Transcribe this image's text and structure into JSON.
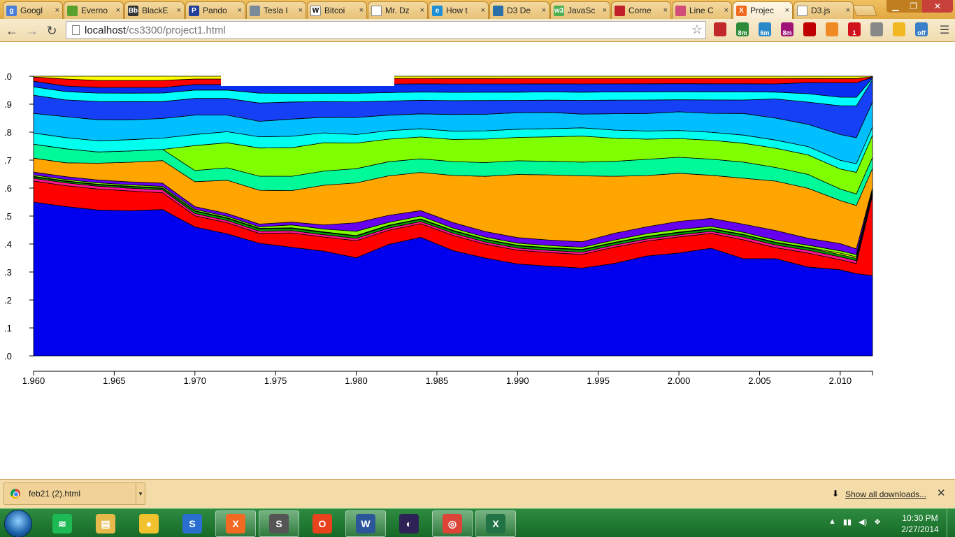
{
  "browser": {
    "tabs": [
      {
        "title": "Googl",
        "icon": "google-icon",
        "color": "#4a7ed8",
        "glyph": "g"
      },
      {
        "title": "Everno",
        "icon": "evernote-icon",
        "color": "#5aa02c",
        "glyph": ""
      },
      {
        "title": "BlackE",
        "icon": "blackboard-icon",
        "color": "#333333",
        "glyph": "Bb"
      },
      {
        "title": "Pando",
        "icon": "pandora-icon",
        "color": "#224099",
        "glyph": "P"
      },
      {
        "title": "Tesla I",
        "icon": "tesla-icon",
        "color": "#7a8a99",
        "glyph": ""
      },
      {
        "title": "Bitcoi",
        "icon": "wikipedia-icon",
        "color": "#ffffff",
        "glyph": "W"
      },
      {
        "title": "Mr. Dz",
        "icon": "page-icon",
        "color": "#ffffff",
        "glyph": ""
      },
      {
        "title": "How t",
        "icon": "ie-icon",
        "color": "#1f8fd6",
        "glyph": "e"
      },
      {
        "title": "D3 De",
        "icon": "d3-icon",
        "color": "#2a6fa8",
        "glyph": ""
      },
      {
        "title": "JavaSc",
        "icon": "w3schools-icon",
        "color": "#4caf50",
        "glyph": "w3"
      },
      {
        "title": "Corne",
        "icon": "cornell-icon",
        "color": "#c0202a",
        "glyph": ""
      },
      {
        "title": "Line C",
        "icon": "line-chart-icon",
        "color": "#d24d7a",
        "glyph": ""
      },
      {
        "title": "Projec",
        "icon": "xampp-icon",
        "color": "#f26a21",
        "glyph": "X",
        "active": true
      },
      {
        "title": "D3.js",
        "icon": "page-icon",
        "color": "#ffffff",
        "glyph": ""
      }
    ],
    "url_host": "localhost",
    "url_path": "/cs3300/project1.html",
    "extensions": [
      {
        "name": "bookmark-ext-icon",
        "color": "#c0282a",
        "badge": ""
      },
      {
        "name": "timer-ext-icon-1",
        "color": "#2e8b3a",
        "badge": "8m"
      },
      {
        "name": "timer-ext-icon-2",
        "color": "#2a87c8",
        "badge": "6m"
      },
      {
        "name": "timer-ext-icon-3",
        "color": "#a0147a",
        "badge": "8m"
      },
      {
        "name": "adblock-ext-icon",
        "color": "#c00000",
        "badge": ""
      },
      {
        "name": "rss-ext-icon",
        "color": "#f08a24",
        "badge": ""
      },
      {
        "name": "feedly-ext-icon",
        "color": "#d0101a",
        "badge": "1"
      },
      {
        "name": "gear-ext-icon",
        "color": "#888888",
        "badge": ""
      },
      {
        "name": "weather-ext-icon",
        "color": "#f2b824",
        "badge": ""
      },
      {
        "name": "download-ext-icon",
        "color": "#3a7fc8",
        "badge": "off"
      }
    ]
  },
  "downloads": {
    "item_label": "feb21 (2).html",
    "show_all": "Show all downloads..."
  },
  "taskbar": {
    "apps": [
      {
        "name": "spotify-icon",
        "color": "#1db954",
        "glyph": "≋",
        "running": false
      },
      {
        "name": "file-explorer-icon",
        "color": "#e7b84a",
        "glyph": "▤",
        "running": false
      },
      {
        "name": "beetle-app-icon",
        "color": "#f2c12e",
        "glyph": "●",
        "running": false
      },
      {
        "name": "sync-app-icon",
        "color": "#2a6fd0",
        "glyph": "S",
        "running": false
      },
      {
        "name": "xampp-icon",
        "color": "#f26a21",
        "glyph": "X",
        "running": true
      },
      {
        "name": "sublime-text-icon",
        "color": "#555555",
        "glyph": "S",
        "running": true
      },
      {
        "name": "office-icon",
        "color": "#e8431c",
        "glyph": "O",
        "running": false
      },
      {
        "name": "word-icon",
        "color": "#2b579a",
        "glyph": "W",
        "running": true
      },
      {
        "name": "eclipse-icon",
        "color": "#2c2255",
        "glyph": "◐",
        "running": false
      },
      {
        "name": "chrome-icon",
        "color": "#db4437",
        "glyph": "◎",
        "running": true
      },
      {
        "name": "excel-icon",
        "color": "#217346",
        "glyph": "X",
        "running": true
      }
    ],
    "time": "10:30 PM",
    "date": "2/27/2014"
  },
  "chart_data": {
    "type": "area",
    "stacked": true,
    "normalized": true,
    "x": [
      1960,
      1962,
      1964,
      1966,
      1968,
      1970,
      1972,
      1974,
      1976,
      1978,
      1980,
      1982,
      1984,
      1986,
      1988,
      1990,
      1992,
      1994,
      1996,
      1998,
      2000,
      2002,
      2004,
      2006,
      2008,
      2010,
      2011,
      2012
    ],
    "xticks": [
      1960,
      1965,
      1970,
      1975,
      1980,
      1985,
      1990,
      1995,
      2000,
      2005,
      2010
    ],
    "xtick_labels": [
      "1.960",
      "1.965",
      "1.970",
      "1.975",
      "1.980",
      "1.985",
      "1.990",
      "1.995",
      "2.000",
      "2.005",
      "2.010"
    ],
    "yticks": [
      0,
      0.1,
      0.2,
      0.3,
      0.4,
      0.5,
      0.6,
      0.7,
      0.8,
      0.9,
      1.0
    ],
    "ytick_labels": [
      ".0",
      ".1",
      ".2",
      ".3",
      ".4",
      ".5",
      ".6",
      ".7",
      ".8",
      ".9",
      ".0"
    ],
    "xlim": [
      1960,
      2012
    ],
    "ylim": [
      0,
      1
    ],
    "series": [
      {
        "color": "#0000ee",
        "values": [
          0.55,
          0.535,
          0.52,
          0.515,
          0.52,
          0.465,
          0.44,
          0.4,
          0.38,
          0.37,
          0.345,
          0.395,
          0.435,
          0.38,
          0.355,
          0.335,
          0.33,
          0.32,
          0.34,
          0.37,
          0.385,
          0.4,
          0.36,
          0.355,
          0.32,
          0.3,
          0.285,
          0.29
        ]
      },
      {
        "color": "#ff0000",
        "values": [
          0.075,
          0.075,
          0.075,
          0.07,
          0.06,
          0.04,
          0.04,
          0.035,
          0.05,
          0.05,
          0.06,
          0.05,
          0.05,
          0.055,
          0.05,
          0.05,
          0.05,
          0.05,
          0.06,
          0.055,
          0.06,
          0.055,
          0.07,
          0.04,
          0.05,
          0.035,
          0.035,
          0.29
        ]
      },
      {
        "color": "#ff1493",
        "values": [
          0.01,
          0.01,
          0.01,
          0.01,
          0.01,
          0.008,
          0.008,
          0.008,
          0.008,
          0.008,
          0.008,
          0.008,
          0.008,
          0.008,
          0.008,
          0.008,
          0.008,
          0.008,
          0.008,
          0.008,
          0.008,
          0.008,
          0.01,
          0.01,
          0.01,
          0.01,
          0.01,
          0.008
        ]
      },
      {
        "color": "#00a000",
        "values": [
          0.005,
          0.005,
          0.005,
          0.005,
          0.005,
          0.008,
          0.008,
          0.008,
          0.008,
          0.008,
          0.008,
          0.008,
          0.008,
          0.008,
          0.008,
          0.008,
          0.008,
          0.008,
          0.008,
          0.008,
          0.008,
          0.008,
          0.008,
          0.008,
          0.008,
          0.008,
          0.008,
          0.006
        ]
      },
      {
        "color": "#ffff00",
        "values": [
          0.002,
          0.002,
          0.002,
          0.002,
          0.002,
          0.002,
          0.002,
          0.002,
          0.002,
          0.002,
          0.002,
          0.002,
          0.002,
          0.002,
          0.002,
          0.002,
          0.002,
          0.002,
          0.002,
          0.002,
          0.002,
          0.002,
          0.002,
          0.002,
          0.002,
          0.005,
          0.005,
          0.003
        ]
      },
      {
        "color": "#7fff00",
        "values": [
          0.005,
          0.005,
          0.005,
          0.005,
          0.005,
          0.005,
          0.005,
          0.005,
          0.01,
          0.01,
          0.015,
          0.01,
          0.01,
          0.008,
          0.008,
          0.008,
          0.008,
          0.008,
          0.008,
          0.01,
          0.01,
          0.008,
          0.008,
          0.008,
          0.008,
          0.008,
          0.008,
          0.006
        ]
      },
      {
        "color": "#6600ee",
        "values": [
          0.01,
          0.01,
          0.01,
          0.01,
          0.012,
          0.01,
          0.01,
          0.01,
          0.01,
          0.015,
          0.03,
          0.025,
          0.02,
          0.02,
          0.02,
          0.02,
          0.02,
          0.02,
          0.025,
          0.025,
          0.03,
          0.03,
          0.03,
          0.035,
          0.025,
          0.025,
          0.02,
          0.004
        ]
      },
      {
        "color": "#ffa500",
        "values": [
          0.05,
          0.05,
          0.06,
          0.07,
          0.08,
          0.09,
          0.12,
          0.12,
          0.11,
          0.14,
          0.14,
          0.14,
          0.14,
          0.17,
          0.2,
          0.23,
          0.24,
          0.24,
          0.21,
          0.19,
          0.18,
          0.16,
          0.17,
          0.18,
          0.18,
          0.15,
          0.15,
          0.07
        ]
      },
      {
        "color": "#00fa9a",
        "values": [
          0.05,
          0.05,
          0.04,
          0.04,
          0.04,
          0.04,
          0.045,
          0.05,
          0.05,
          0.05,
          0.05,
          0.05,
          0.05,
          0.05,
          0.05,
          0.05,
          0.05,
          0.05,
          0.055,
          0.06,
          0.06,
          0.06,
          0.06,
          0.05,
          0.05,
          0.04,
          0.04,
          0.04
        ]
      },
      {
        "color": "#7fff00",
        "values": [
          0.0,
          0.0,
          0.0,
          0.0,
          0.0,
          0.09,
          0.09,
          0.1,
          0.1,
          0.1,
          0.09,
          0.08,
          0.08,
          0.08,
          0.085,
          0.085,
          0.09,
          0.095,
          0.085,
          0.075,
          0.07,
          0.07,
          0.07,
          0.07,
          0.07,
          0.07,
          0.075,
          0.08
        ]
      },
      {
        "color": "#00ffee",
        "values": [
          0.04,
          0.04,
          0.04,
          0.04,
          0.04,
          0.04,
          0.04,
          0.04,
          0.04,
          0.035,
          0.03,
          0.03,
          0.03,
          0.03,
          0.03,
          0.03,
          0.03,
          0.03,
          0.03,
          0.03,
          0.03,
          0.03,
          0.03,
          0.03,
          0.03,
          0.03,
          0.03,
          0.03
        ]
      },
      {
        "color": "#00bfff",
        "values": [
          0.07,
          0.075,
          0.075,
          0.07,
          0.07,
          0.07,
          0.06,
          0.055,
          0.06,
          0.055,
          0.06,
          0.055,
          0.055,
          0.06,
          0.06,
          0.06,
          0.06,
          0.05,
          0.06,
          0.065,
          0.07,
          0.07,
          0.08,
          0.08,
          0.08,
          0.09,
          0.09,
          0.09
        ]
      },
      {
        "color": "#1540f5",
        "values": [
          0.065,
          0.06,
          0.065,
          0.065,
          0.06,
          0.06,
          0.06,
          0.065,
          0.06,
          0.055,
          0.055,
          0.05,
          0.05,
          0.05,
          0.05,
          0.045,
          0.045,
          0.05,
          0.05,
          0.05,
          0.045,
          0.05,
          0.05,
          0.07,
          0.08,
          0.1,
          0.11,
          0.08
        ]
      },
      {
        "color": "#00ffff",
        "values": [
          0.03,
          0.03,
          0.03,
          0.03,
          0.03,
          0.03,
          0.03,
          0.035,
          0.03,
          0.03,
          0.03,
          0.03,
          0.03,
          0.03,
          0.03,
          0.03,
          0.03,
          0.03,
          0.03,
          0.03,
          0.03,
          0.03,
          0.03,
          0.025,
          0.03,
          0.03,
          0.03,
          0.006
        ]
      },
      {
        "color": "#0a2ef0",
        "values": [
          0.02,
          0.02,
          0.02,
          0.02,
          0.02,
          0.02,
          0.02,
          0.03,
          0.03,
          0.03,
          0.03,
          0.03,
          0.03,
          0.03,
          0.03,
          0.03,
          0.03,
          0.03,
          0.03,
          0.03,
          0.03,
          0.03,
          0.03,
          0.03,
          0.04,
          0.05,
          0.05,
          0.003
        ]
      },
      {
        "color": "#ff0000",
        "values": [
          0.015,
          0.025,
          0.025,
          0.025,
          0.025,
          0.02,
          0.02,
          0.02,
          0.02,
          0.02,
          0.02,
          0.02,
          0.02,
          0.02,
          0.02,
          0.02,
          0.02,
          0.02,
          0.02,
          0.02,
          0.02,
          0.02,
          0.02,
          0.02,
          0.015,
          0.015,
          0.015,
          0.002
        ]
      },
      {
        "color": "#ffff00",
        "values": [
          0.003,
          0.01,
          0.015,
          0.015,
          0.015,
          0.01,
          0.01,
          0.01,
          0.01,
          0.01,
          0.01,
          0.008,
          0.008,
          0.008,
          0.008,
          0.008,
          0.008,
          0.008,
          0.008,
          0.008,
          0.008,
          0.008,
          0.008,
          0.008,
          0.008,
          0.008,
          0.008,
          0.002
        ]
      }
    ]
  }
}
